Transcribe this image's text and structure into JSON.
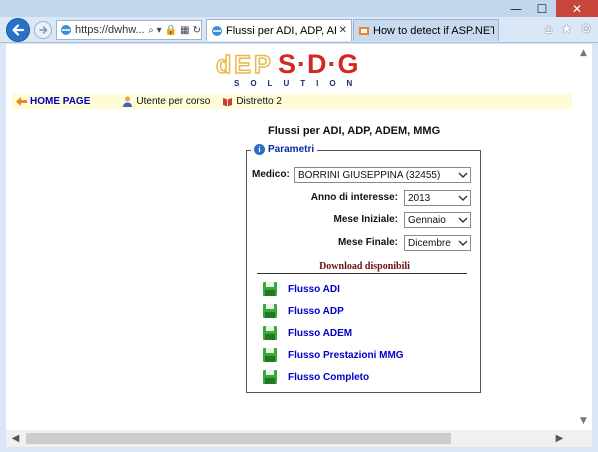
{
  "window": {
    "minimize": "—",
    "maximize": "☐",
    "close": "✕"
  },
  "browser": {
    "address_text": "https://dwhw...",
    "tabs": [
      {
        "label": "Flussi per ADI, ADP, ADEM, ...",
        "active": true
      },
      {
        "label": "How to detect if ASP.NET is en...",
        "active": false
      }
    ],
    "tool_icons": [
      "home-icon",
      "star-icon",
      "gear-icon"
    ]
  },
  "logo": {
    "left_text": "dEP",
    "right_text": "S·D·G",
    "sub_text": "SOLUTION"
  },
  "menu": {
    "home": "HOME PAGE",
    "user": "Utente per corso",
    "district": "Distretto 2"
  },
  "page": {
    "title": "Flussi per ADI, ADP, ADEM, MMG"
  },
  "panel": {
    "legend": "Parametri",
    "medico_label": "Medico:",
    "medico_value": "BORRINI GIUSEPPINA (32455)",
    "anno_label": "Anno di interesse:",
    "anno_value": "2013",
    "mese_iniziale_label": "Mese Iniziale:",
    "mese_iniziale_value": "Gennaio",
    "mese_finale_label": "Mese Finale:",
    "mese_finale_value": "Dicembre",
    "downloads_heading": "Download disponibili",
    "downloads": [
      "Flusso ADI",
      "Flusso ADP",
      "Flusso ADEM",
      "Flusso Prestazioni MMG",
      "Flusso Completo"
    ]
  },
  "colors": {
    "link_blue": "#0000c8",
    "menu_bg": "#fefbd6",
    "logo_red": "#d3281f",
    "download_heading": "#6b1010",
    "floppy_green": "#3aa83a"
  }
}
